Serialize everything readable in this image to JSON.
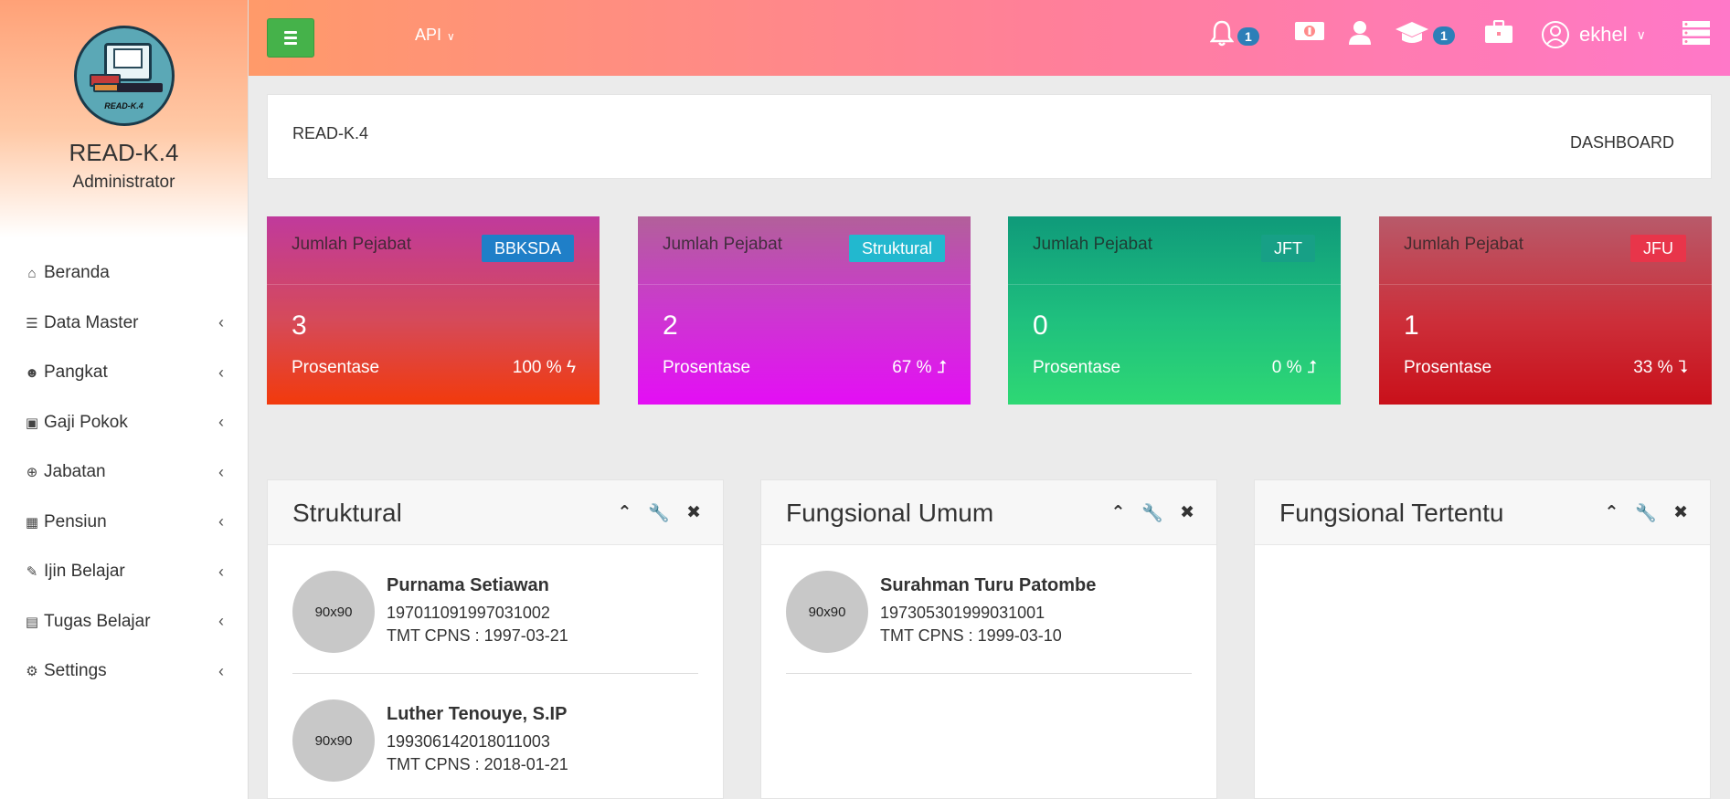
{
  "sidebar": {
    "app_name": "READ-K.4",
    "role": "Administrator",
    "logo_text": "READ-K.4",
    "items": [
      {
        "label": "Beranda",
        "icon": "home-icon",
        "glyph": "⌂",
        "has_children": false
      },
      {
        "label": "Data Master",
        "icon": "database-icon",
        "glyph": "☰",
        "has_children": true
      },
      {
        "label": "Pangkat",
        "icon": "users-icon",
        "glyph": "☻",
        "has_children": true
      },
      {
        "label": "Gaji Pokok",
        "icon": "money-icon",
        "glyph": "▣",
        "has_children": true
      },
      {
        "label": "Jabatan",
        "icon": "plus-circle-icon",
        "glyph": "⊕",
        "has_children": true
      },
      {
        "label": "Pensiun",
        "icon": "calendar-icon",
        "glyph": "▦",
        "has_children": true
      },
      {
        "label": "Ijin Belajar",
        "icon": "edit-icon",
        "glyph": "✎",
        "has_children": true
      },
      {
        "label": "Tugas Belajar",
        "icon": "briefcase-icon",
        "glyph": "▤",
        "has_children": true
      },
      {
        "label": "Settings",
        "icon": "cogs-icon",
        "glyph": "⚙",
        "has_children": true
      }
    ],
    "chevron": "‹"
  },
  "header": {
    "api_label": "API",
    "notifications_count": "1",
    "graduation_count": "1",
    "user_name": "ekhel"
  },
  "breadcrumb": {
    "title": "READ-K.4",
    "right": "DASHBOARD"
  },
  "stats": [
    {
      "label": "Jumlah Pejabat",
      "tag": "BBKSDA",
      "value": "3",
      "pct_label": "Prosentase",
      "pct": "100 %",
      "trend": "ϟ",
      "tag_color": "#1f7fc8"
    },
    {
      "label": "Jumlah Pejabat",
      "tag": "Struktural",
      "value": "2",
      "pct_label": "Prosentase",
      "pct": "67 %",
      "trend": "⮥",
      "tag_color": "#22b8cf"
    },
    {
      "label": "Jumlah Pejabat",
      "tag": "JFT",
      "value": "0",
      "pct_label": "Prosentase",
      "pct": "0 %",
      "trend": "⮥",
      "tag_color": "#17a086"
    },
    {
      "label": "Jumlah Pejabat",
      "tag": "JFU",
      "value": "1",
      "pct_label": "Prosentase",
      "pct": "33 %",
      "trend": "⮧",
      "tag_color": "#e8354a"
    }
  ],
  "panels": [
    {
      "title": "Struktural",
      "people": [
        {
          "avatar": "90x90",
          "name": "Purnama Setiawan",
          "nip": "197011091997031002",
          "tmt": "TMT CPNS : 1997-03-21"
        },
        {
          "avatar": "90x90",
          "name": "Luther Tenouye, S.IP",
          "nip": "199306142018011003",
          "tmt": "TMT CPNS : 2018-01-21"
        }
      ]
    },
    {
      "title": "Fungsional Umum",
      "people": [
        {
          "avatar": "90x90",
          "name": "Surahman Turu Patombe",
          "nip": "197305301999031001",
          "tmt": "TMT CPNS : 1999-03-10"
        }
      ]
    },
    {
      "title": "Fungsional Tertentu",
      "people": []
    }
  ]
}
